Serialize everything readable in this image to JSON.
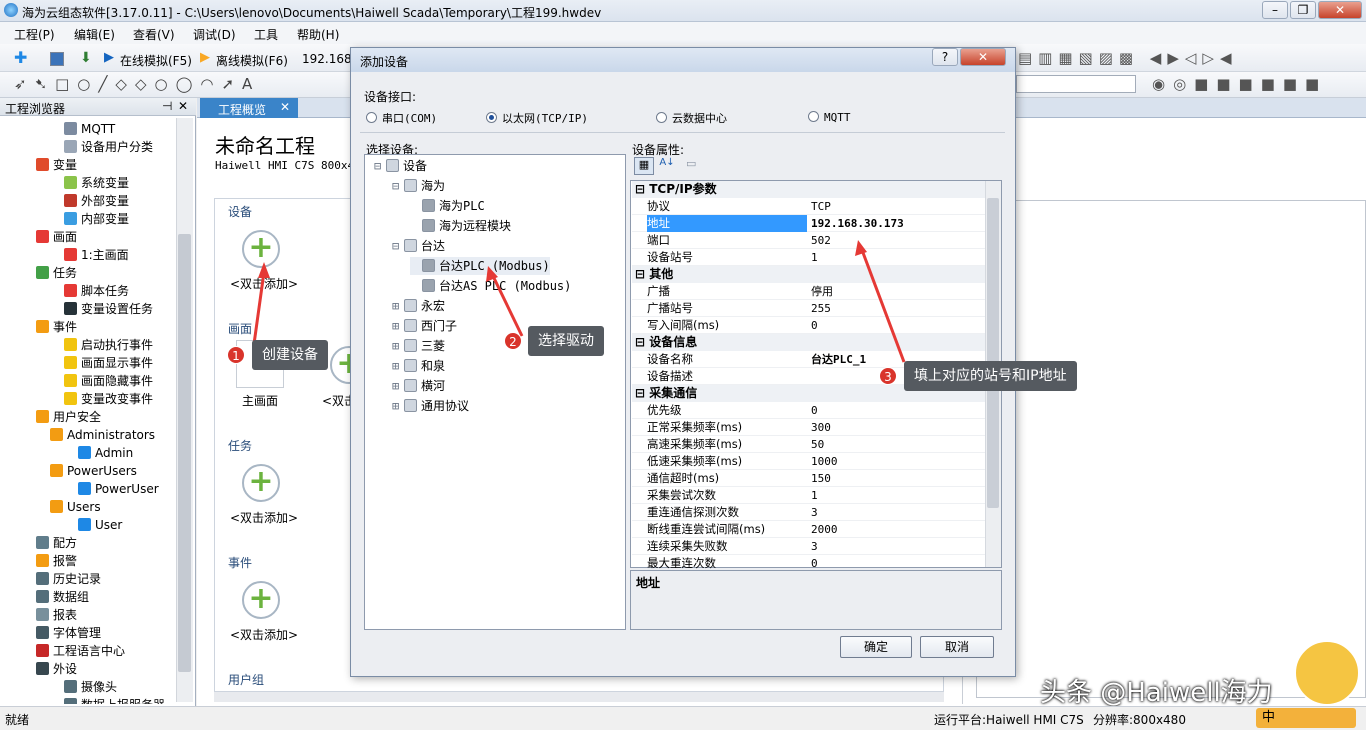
{
  "window": {
    "title": "海为云组态软件[3.17.0.11] - C:\\Users\\lenovo\\Documents\\Haiwell Scada\\Temporary\\工程199.hwdev"
  },
  "menu": [
    "工程(P)",
    "编辑(E)",
    "查看(V)",
    "调试(D)",
    "工具",
    "帮助(H)"
  ],
  "toolbar": {
    "online_sim": "在线模拟(F5)",
    "offline_sim": "离线模拟(F6)",
    "ip_partial": "192.168."
  },
  "left_panel": {
    "title": "工程浏览器",
    "items": [
      {
        "label": "MQTT",
        "indent": 3,
        "icon": "#7c8ba0"
      },
      {
        "label": "设备用户分类",
        "indent": 3,
        "icon": "#9aa6b6"
      },
      {
        "label": "变量",
        "indent": 1,
        "icon": "#e04b2b"
      },
      {
        "label": "系统变量",
        "indent": 3,
        "icon": "#8bc34a"
      },
      {
        "label": "外部变量",
        "indent": 3,
        "icon": "#c0392b"
      },
      {
        "label": "内部变量",
        "indent": 3,
        "icon": "#3a9de1"
      },
      {
        "label": "画面",
        "indent": 1,
        "icon": "#e53935"
      },
      {
        "label": "1:主画面",
        "indent": 3,
        "icon": "#e53935"
      },
      {
        "label": "任务",
        "indent": 1,
        "icon": "#43a047"
      },
      {
        "label": "脚本任务",
        "indent": 3,
        "icon": "#e53935"
      },
      {
        "label": "变量设置任务",
        "indent": 3,
        "icon": "#263238"
      },
      {
        "label": "事件",
        "indent": 1,
        "icon": "#f39c12"
      },
      {
        "label": "启动执行事件",
        "indent": 3,
        "icon": "#f1c40f"
      },
      {
        "label": "画面显示事件",
        "indent": 3,
        "icon": "#f1c40f"
      },
      {
        "label": "画面隐藏事件",
        "indent": 3,
        "icon": "#f1c40f"
      },
      {
        "label": "变量改变事件",
        "indent": 3,
        "icon": "#f1c40f"
      },
      {
        "label": "用户安全",
        "indent": 1,
        "icon": "#f39c12"
      },
      {
        "label": "Administrators",
        "indent": 2,
        "icon": "#f39c12"
      },
      {
        "label": "Admin",
        "indent": 4,
        "icon": "#1e88e5"
      },
      {
        "label": "PowerUsers",
        "indent": 2,
        "icon": "#f39c12"
      },
      {
        "label": "PowerUser",
        "indent": 4,
        "icon": "#1e88e5"
      },
      {
        "label": "Users",
        "indent": 2,
        "icon": "#f39c12"
      },
      {
        "label": "User",
        "indent": 4,
        "icon": "#1e88e5"
      },
      {
        "label": "配方",
        "indent": 1,
        "icon": "#607d8b"
      },
      {
        "label": "报警",
        "indent": 1,
        "icon": "#f39c12"
      },
      {
        "label": "历史记录",
        "indent": 1,
        "icon": "#546e7a"
      },
      {
        "label": "数据组",
        "indent": 1,
        "icon": "#546e7a"
      },
      {
        "label": "报表",
        "indent": 1,
        "icon": "#78909c"
      },
      {
        "label": "字体管理",
        "indent": 1,
        "icon": "#455a64"
      },
      {
        "label": "工程语言中心",
        "indent": 1,
        "icon": "#c62828"
      },
      {
        "label": "外设",
        "indent": 1,
        "icon": "#37474f"
      },
      {
        "label": "摄像头",
        "indent": 3,
        "icon": "#546e7a"
      },
      {
        "label": "数据上报服务器",
        "indent": 3,
        "icon": "#546e7a"
      }
    ]
  },
  "doc": {
    "tab": "工程概览",
    "project_title": "未命名工程",
    "project_sub": "Haiwell HMI C7S  800x48",
    "sections": {
      "device": "设备",
      "screen": "画面",
      "task": "任务",
      "event": "事件",
      "usergroup": "用户组"
    },
    "add_label": "<双击添加>",
    "add_label_short": "<双击",
    "main_screen": "主画面"
  },
  "dialog": {
    "title": "添加设备",
    "interface_label": "设备接口:",
    "interfaces": [
      {
        "label": "串口(COM)",
        "selected": false
      },
      {
        "label": "以太网(TCP/IP)",
        "selected": true
      },
      {
        "label": "云数据中心",
        "selected": false
      },
      {
        "label": "MQTT",
        "selected": false
      }
    ],
    "select_label": "选择设备:",
    "device_tree": [
      {
        "label": "设备",
        "indent": 0
      },
      {
        "label": "海为",
        "indent": 1
      },
      {
        "label": "海为PLC",
        "indent": 2
      },
      {
        "label": "海为远程模块",
        "indent": 2
      },
      {
        "label": "台达",
        "indent": 1
      },
      {
        "label": "台达PLC (Modbus)",
        "indent": 2
      },
      {
        "label": "台达AS PLC (Modbus)",
        "indent": 2
      },
      {
        "label": "永宏",
        "indent": 1
      },
      {
        "label": "西门子",
        "indent": 1
      },
      {
        "label": "三菱",
        "indent": 1
      },
      {
        "label": "和泉",
        "indent": 1
      },
      {
        "label": "横河",
        "indent": 1
      },
      {
        "label": "通用协议",
        "indent": 1
      }
    ],
    "props_label": "设备属性:",
    "props": [
      {
        "group": "TCP/IP参数"
      },
      {
        "name": "协议",
        "value": "TCP"
      },
      {
        "name": "地址",
        "value": "192.168.30.173",
        "selected": true
      },
      {
        "name": "端口",
        "value": "502"
      },
      {
        "name": "设备站号",
        "value": "1"
      },
      {
        "group": "其他"
      },
      {
        "name": "广播",
        "value": "停用"
      },
      {
        "name": "广播站号",
        "value": "255"
      },
      {
        "name": "写入间隔(ms)",
        "value": "0"
      },
      {
        "group": "设备信息"
      },
      {
        "name": "设备名称",
        "value": "台达PLC_1",
        "bold": true
      },
      {
        "name": "设备描述",
        "value": ""
      },
      {
        "group": "采集通信"
      },
      {
        "name": "优先级",
        "value": "0"
      },
      {
        "name": "正常采集频率(ms)",
        "value": "300"
      },
      {
        "name": "高速采集频率(ms)",
        "value": "50"
      },
      {
        "name": "低速采集频率(ms)",
        "value": "1000"
      },
      {
        "name": "通信超时(ms)",
        "value": "150"
      },
      {
        "name": "采集尝试次数",
        "value": "1"
      },
      {
        "name": "重连通信探测次数",
        "value": "3"
      },
      {
        "name": "断线重连尝试间隔(ms)",
        "value": "2000"
      },
      {
        "name": "连续采集失败数",
        "value": "3"
      },
      {
        "name": "最大重连次数",
        "value": "0"
      }
    ],
    "desc_title": "地址",
    "ok": "确定",
    "cancel": "取消"
  },
  "annotations": [
    {
      "num": "1",
      "text": "创建设备"
    },
    {
      "num": "2",
      "text": "选择驱动"
    },
    {
      "num": "3",
      "text": "填上对应的站号和IP地址"
    }
  ],
  "status": {
    "left": "就绪",
    "platform": "运行平台:Haiwell HMI C7S",
    "resolution": "分辨率:800x480",
    "ime": "中"
  },
  "watermark": "头条 @Haiwell海力"
}
